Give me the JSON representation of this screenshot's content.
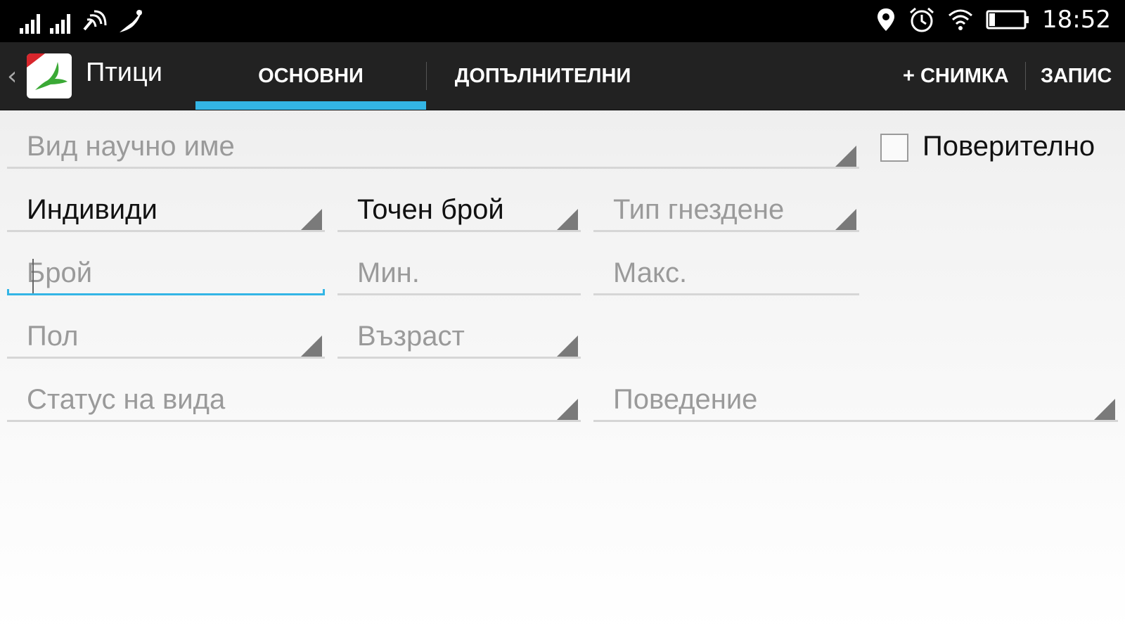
{
  "status_bar": {
    "time": "18:52",
    "icons": [
      "signal-icon",
      "signal-icon",
      "nfc-icon",
      "bird-notification-icon",
      "location-icon",
      "alarm-icon",
      "wifi-icon",
      "battery-icon"
    ]
  },
  "action_bar": {
    "title": "Птици",
    "tabs": [
      {
        "label": "ОСНОВНИ",
        "active": true
      },
      {
        "label": "ДОПЪЛНИТЕЛНИ",
        "active": false
      }
    ],
    "actions": {
      "photo": "+ СНИМКА",
      "save": "ЗАПИС"
    },
    "accent_color": "#33b5e5",
    "logo_color": "#3aa935"
  },
  "form": {
    "species": {
      "placeholder": "Вид научно име"
    },
    "confidential": {
      "label": "Поверително",
      "checked": false
    },
    "unit": {
      "value": "Индивиди"
    },
    "count_type": {
      "value": "Точен брой"
    },
    "nesting_type": {
      "placeholder": "Тип гнездене"
    },
    "count": {
      "placeholder": "Брой"
    },
    "min": {
      "placeholder": "Мин."
    },
    "max": {
      "placeholder": "Макс."
    },
    "sex": {
      "placeholder": "Пол"
    },
    "age": {
      "placeholder": "Възраст"
    },
    "species_status": {
      "placeholder": "Статус на вида"
    },
    "behaviour": {
      "placeholder": "Поведение"
    }
  }
}
